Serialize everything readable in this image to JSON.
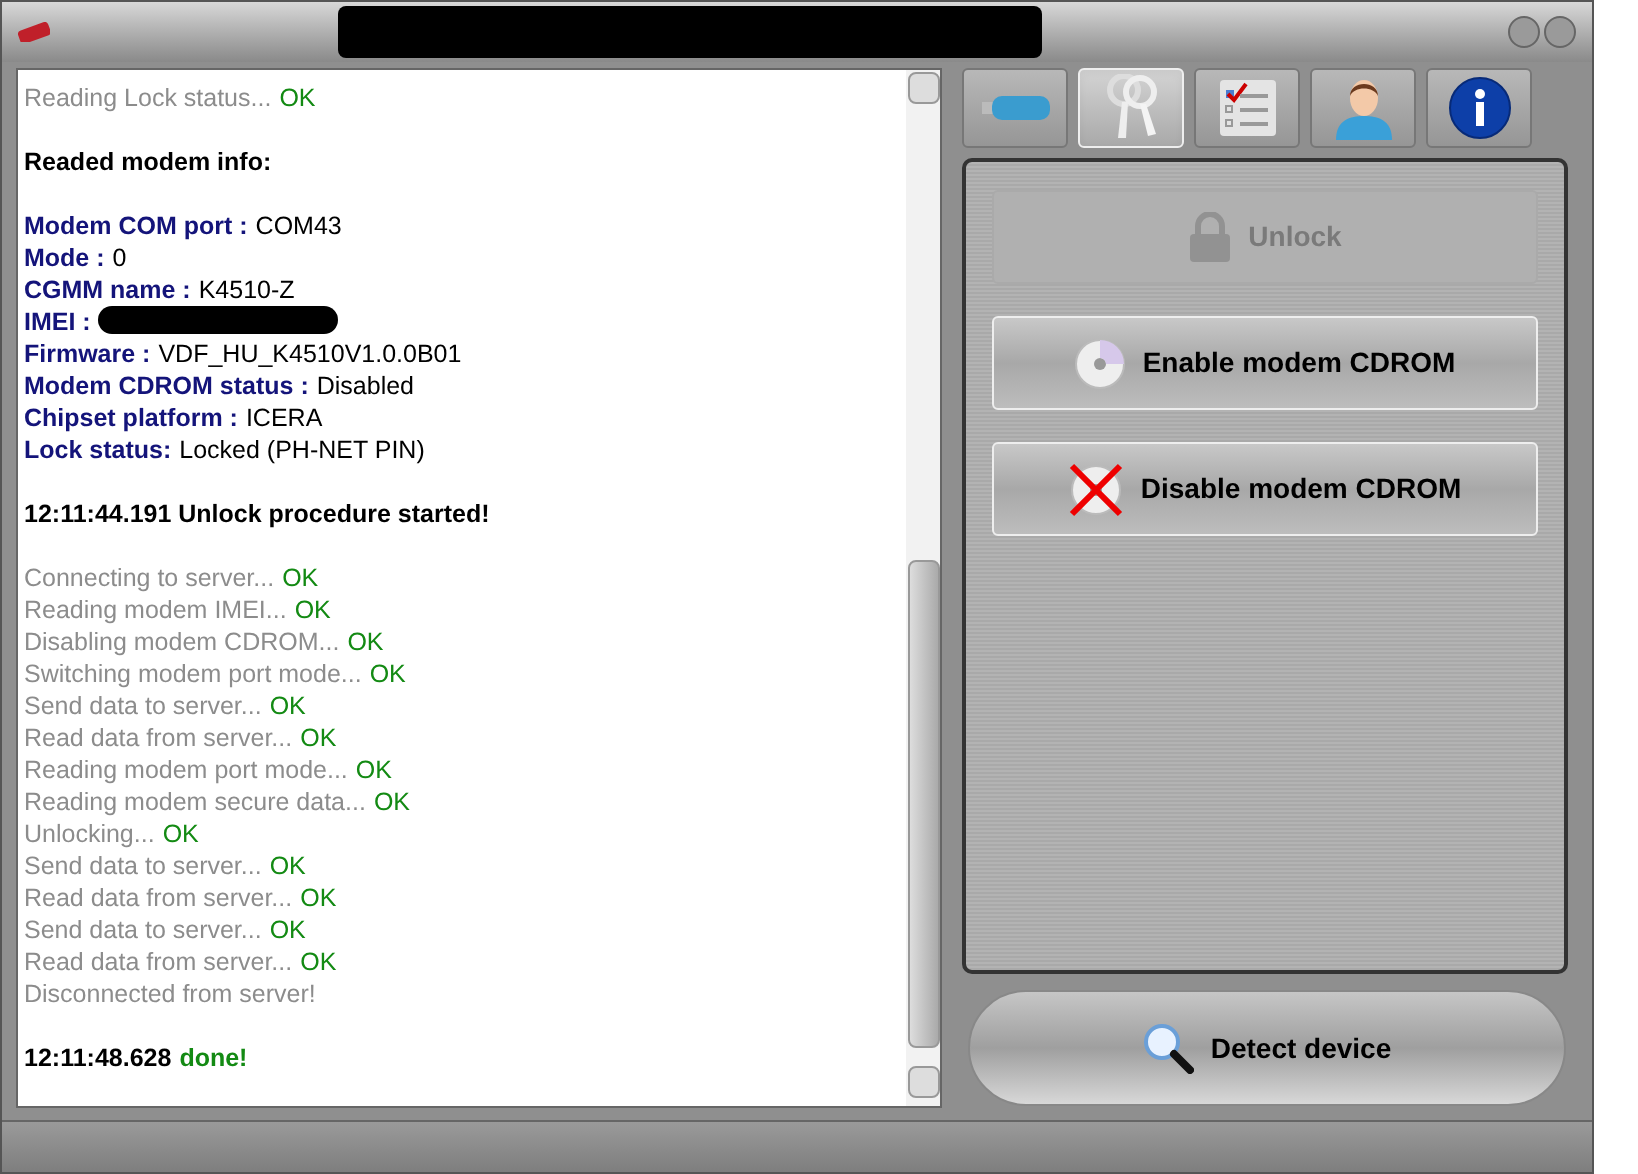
{
  "log": [
    {
      "kind": "status",
      "text": "Reading Lock status...",
      "status": "OK"
    },
    {
      "kind": "blank"
    },
    {
      "kind": "heading",
      "text": "Readed modem info:"
    },
    {
      "kind": "blank"
    },
    {
      "kind": "info",
      "label": "Modem COM port :",
      "value": "COM43"
    },
    {
      "kind": "info",
      "label": "Mode :",
      "value": "0"
    },
    {
      "kind": "info",
      "label": "CGMM name :",
      "value": "K4510-Z"
    },
    {
      "kind": "info",
      "label": "IMEI :",
      "redacted": true
    },
    {
      "kind": "info",
      "label": "Firmware :",
      "value": "VDF_HU_K4510V1.0.0B01"
    },
    {
      "kind": "info",
      "label": "Modem CDROM status :",
      "value": "Disabled"
    },
    {
      "kind": "info",
      "label": "Chipset platform :",
      "value": "ICERA"
    },
    {
      "kind": "info",
      "label": "Lock status:",
      "value": "Locked (PH-NET PIN)"
    },
    {
      "kind": "blank"
    },
    {
      "kind": "heading",
      "text": "12:11:44.191 Unlock procedure started!"
    },
    {
      "kind": "blank"
    },
    {
      "kind": "status",
      "text": "Connecting to server...",
      "status": "OK"
    },
    {
      "kind": "status",
      "text": "Reading modem IMEI...",
      "status": "OK"
    },
    {
      "kind": "status",
      "text": "Disabling modem CDROM...",
      "status": "OK"
    },
    {
      "kind": "status",
      "text": "Switching modem port mode...",
      "status": "OK"
    },
    {
      "kind": "status",
      "text": "Send data to server...",
      "status": "OK"
    },
    {
      "kind": "status",
      "text": "Read data from server...",
      "status": "OK"
    },
    {
      "kind": "status",
      "text": "Reading modem port mode...",
      "status": "OK"
    },
    {
      "kind": "status",
      "text": "Reading modem secure data...",
      "status": "OK"
    },
    {
      "kind": "status",
      "text": "Unlocking...",
      "status": "OK"
    },
    {
      "kind": "status",
      "text": "Send data to server...",
      "status": "OK"
    },
    {
      "kind": "status",
      "text": "Read data from server...",
      "status": "OK"
    },
    {
      "kind": "status",
      "text": "Send data to server...",
      "status": "OK"
    },
    {
      "kind": "status",
      "text": "Read data from server...",
      "status": "OK"
    },
    {
      "kind": "status",
      "text": "Disconnected from server!"
    },
    {
      "kind": "blank"
    },
    {
      "kind": "done",
      "time": "12:11:48.628",
      "text": "done!"
    }
  ],
  "tabs": [
    {
      "kind": "usb",
      "selected": false
    },
    {
      "kind": "keys",
      "selected": true
    },
    {
      "kind": "checklist",
      "selected": false
    },
    {
      "kind": "user",
      "selected": false
    },
    {
      "kind": "info",
      "selected": false
    }
  ],
  "actions": [
    {
      "kind": "lock",
      "label": "Unlock",
      "disabled": true
    },
    {
      "kind": "cd",
      "label": "Enable modem CDROM",
      "disabled": false
    },
    {
      "kind": "cd-off",
      "label": "Disable modem CDROM",
      "disabled": false
    }
  ],
  "detect_button": {
    "label": "Detect device"
  }
}
